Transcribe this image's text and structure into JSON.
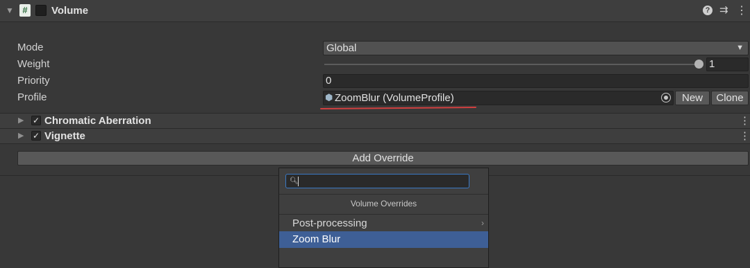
{
  "component": {
    "title": "Volume",
    "script_icon": "#",
    "icons": [
      "collapse-arrow-icon",
      "script-icon",
      "help-icon",
      "presets-icon",
      "menu-icon"
    ]
  },
  "properties": {
    "mode": {
      "label": "Mode",
      "value": "Global"
    },
    "weight": {
      "label": "Weight",
      "value": "1",
      "slider_fraction": 1.0
    },
    "priority": {
      "label": "Priority",
      "value": "0"
    },
    "profile": {
      "label": "Profile",
      "value": "ZoomBlur (VolumeProfile)",
      "new_label": "New",
      "clone_label": "Clone"
    }
  },
  "overrides": [
    {
      "title": "Chromatic Aberration",
      "enabled": true
    },
    {
      "title": "Vignette",
      "enabled": true
    }
  ],
  "add_override_label": "Add Override",
  "popup": {
    "search_value": "",
    "title": "Volume Overrides",
    "items": [
      {
        "label": "Post-processing",
        "has_submenu": true
      },
      {
        "label": "Zoom Blur",
        "selected": true
      }
    ]
  },
  "colors": {
    "background": "#383838",
    "highlight": "#3e5f96",
    "annotation_underline": "#d23f3f",
    "search_focus": "#3a79c5"
  }
}
